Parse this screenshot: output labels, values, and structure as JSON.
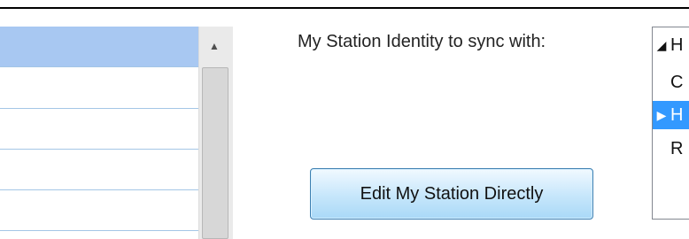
{
  "sync_label": "My Station Identity to sync with:",
  "edit_button_label": "Edit My Station Directly",
  "tree": {
    "items": [
      {
        "icon": "◢",
        "text": "H"
      },
      {
        "icon": "",
        "text": "C"
      },
      {
        "icon": "▶",
        "text": "H"
      },
      {
        "icon": "",
        "text": "R"
      }
    ]
  },
  "scrollbar": {
    "up_arrow": "▲"
  },
  "colors": {
    "selected_row": "#a8c8f2",
    "tree_selected": "#3399ff",
    "button_border": "#3c7fb1"
  }
}
